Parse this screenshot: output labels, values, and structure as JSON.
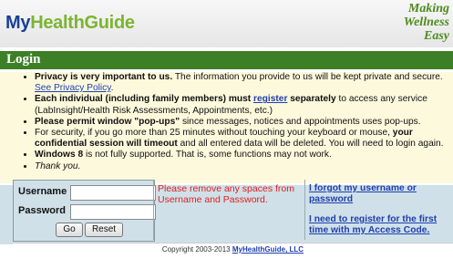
{
  "header": {
    "logo_my": "My",
    "logo_rest": "HealthGuide",
    "tagline": [
      "Making",
      "Wellness",
      "Easy"
    ]
  },
  "login_bar": {
    "title": "Login"
  },
  "notes": {
    "item1_bold": "Privacy is very important to us.",
    "item1_text": " The information you provide to us will be kept private and secure. ",
    "item1_link": "See Privacy Policy",
    "item1_end": ".",
    "item2_bold_a": "Each individual (including family members) must ",
    "item2_link": "register",
    "item2_bold_b": " separately",
    "item2_text": " to access any service (LabInsight/Health Risk Assessments, Appointments, etc.)",
    "item3_bold": "Please permit window \"pop-ups\"",
    "item3_text": " since messages, notices and appointments uses pop-ups.",
    "item4_text": "For security, if you go more than 25 minutes without touching your keyboard or mouse, ",
    "item4_bold": "your confidential session will timeout",
    "item4_end": " and all entered data will be deleted. You will need to login again.",
    "item5_bold": "Windows 8",
    "item5_text": " is not fully supported. That is, some functions may not work.",
    "item6_text": "Thank you."
  },
  "form": {
    "username_label": "Username",
    "password_label": "Password",
    "username_value": "",
    "password_value": "",
    "go_label": "Go",
    "reset_label": "Reset",
    "warning": "Please remove any spaces from Username and Password.",
    "forgot_link": "I forgot my username or password",
    "register_link": "I need to register for the first time with my Access Code."
  },
  "footer": {
    "copyright": "Copyright 2003-2013 ",
    "link": "MyHealthGuide, LLC"
  },
  "colors": {
    "brand_blue": "#1a3f99",
    "brand_green": "#7bb431",
    "bar_green": "#3d7f26",
    "warning_red": "#e02020"
  }
}
